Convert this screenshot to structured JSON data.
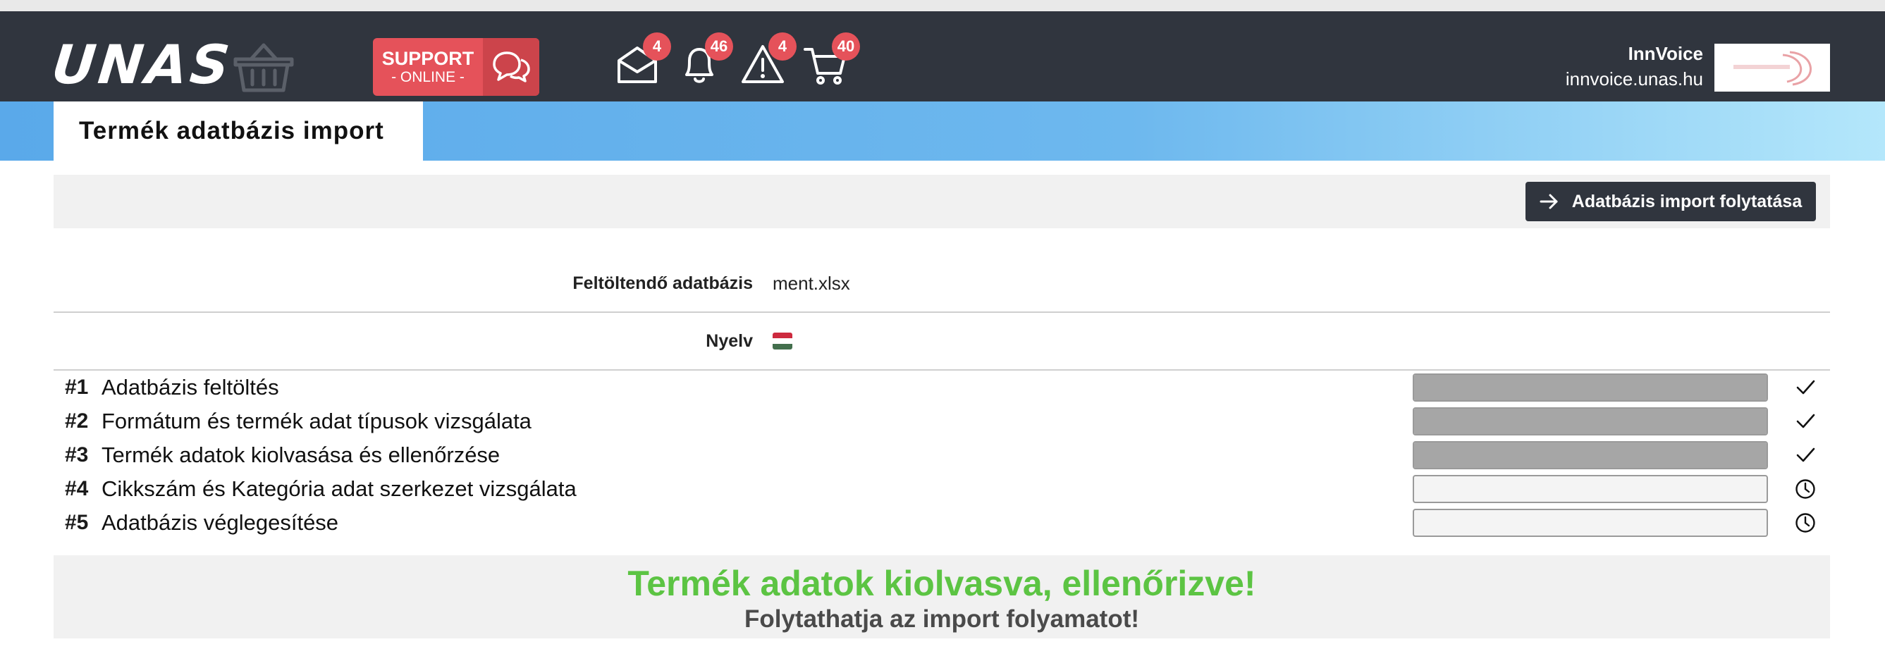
{
  "header": {
    "logo": "UNAS",
    "support": {
      "title": "SUPPORT",
      "subtitle": "- ONLINE -"
    },
    "badges": {
      "messages": "4",
      "notifications": "46",
      "alerts": "4",
      "cart": "40"
    },
    "user": {
      "name": "InnVoice",
      "domain": "innvoice.unas.hu"
    }
  },
  "page": {
    "title": "Termék adatbázis import",
    "continue_label": "Adatbázis import folytatása"
  },
  "info": {
    "file_label": "Feltöltendő adatbázis",
    "file_value": "ment.xlsx",
    "language_label": "Nyelv",
    "language_flag": [
      "#cd2a3e",
      "#ffffff",
      "#436f4d"
    ]
  },
  "steps": [
    {
      "num": "#1",
      "label": "Adatbázis feltöltés",
      "progress": 1,
      "status": "done"
    },
    {
      "num": "#2",
      "label": "Formátum és termék adat típusok vizsgálata",
      "progress": 1,
      "status": "done"
    },
    {
      "num": "#3",
      "label": "Termék adatok kiolvasása és ellenőrzése",
      "progress": 1,
      "status": "done"
    },
    {
      "num": "#4",
      "label": "Cikkszám és Kategória adat szerkezet vizsgálata",
      "progress": 0,
      "status": "pending"
    },
    {
      "num": "#5",
      "label": "Adatbázis véglegesítése",
      "progress": 0,
      "status": "pending"
    }
  ],
  "result": {
    "title": "Termék adatok kiolvasva, ellenőrizve!",
    "subtitle": "Folytathatja az import folyamatot!"
  },
  "colors": {
    "navbar": "#30353e",
    "support": "#e5525a",
    "success": "#5cc443",
    "accent_blue": "#5aa9ea"
  }
}
